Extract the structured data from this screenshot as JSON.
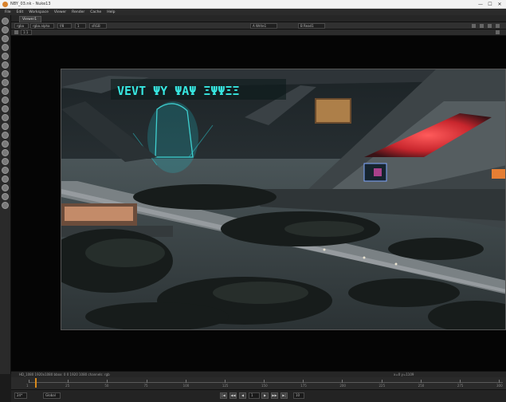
{
  "window": {
    "title": "NBY_03.nk - Nuke13",
    "controls": [
      "—",
      "☐",
      "✕"
    ]
  },
  "menu": [
    "File",
    "Edit",
    "Workspace",
    "Viewer",
    "Render",
    "Cache",
    "Help"
  ],
  "sidebar": {
    "tools": [
      "pointer-icon",
      "paint-icon",
      "clone-icon",
      "blur-icon",
      "grade-icon",
      "merge-icon",
      "transform-icon",
      "3d-icon",
      "particle-icon",
      "deep-icon",
      "views-icon",
      "metadata-icon",
      "toolsets-icon",
      "other-icon",
      "cryptomatte-icon",
      "keyer-icon",
      "channel-icon",
      "time-icon",
      "draw-icon",
      "image-icon",
      "filter-icon",
      "color-icon"
    ]
  },
  "tabs": [
    "Viewer1"
  ],
  "controls": {
    "channels": "rgba",
    "layer": "rgba.alpha",
    "exposure": "f/8",
    "gamma": "1",
    "colorspace": "sRGB",
    "input_a": "A Write1",
    "input_b": "B Read1",
    "proxy": "1:1"
  },
  "info": {
    "status": "HD_1080 1920x1080  bbox: 0 0 1920 1080 channels: rgb",
    "frame": "x=0 y=1109"
  },
  "timeline": {
    "labels": [
      "1",
      "25",
      "50",
      "75",
      "100",
      "125",
      "150",
      "175",
      "200",
      "225",
      "250",
      "275",
      "300"
    ]
  },
  "transport": {
    "fps": "24*",
    "global": "Global",
    "frame": "1",
    "step": "10",
    "buttons": [
      "|◀",
      "◀◀",
      "◀",
      "▶",
      "▶▶",
      "▶|"
    ]
  }
}
